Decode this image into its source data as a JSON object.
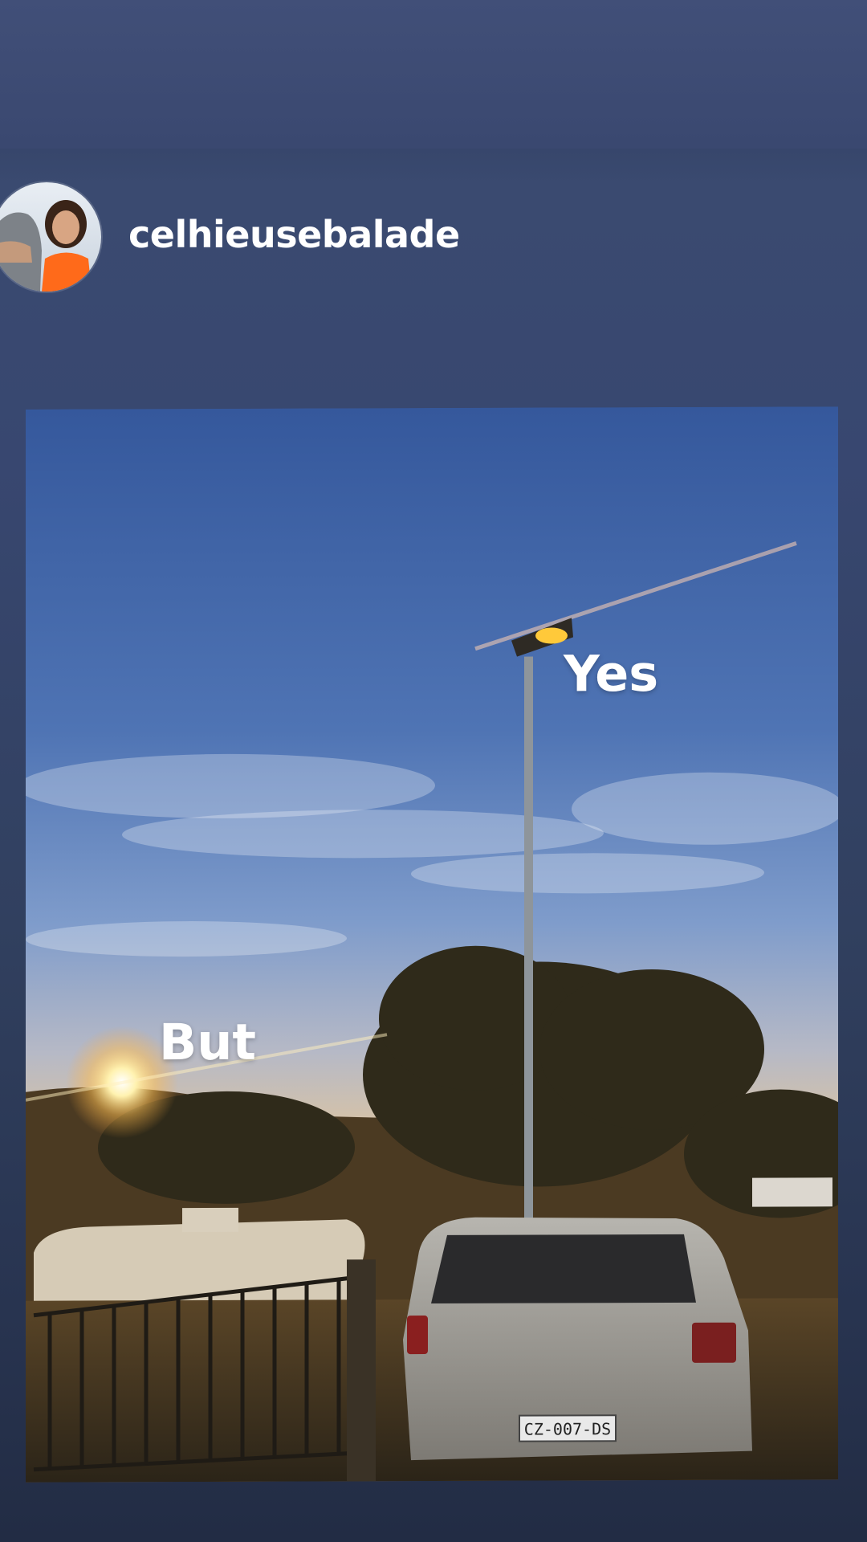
{
  "story": {
    "username": "celhieusebalade",
    "avatar_icon": "profile-avatar-icon",
    "stickers": {
      "yes": "Yes",
      "but": "But"
    },
    "photo": {
      "license_plate": "CZ-007-DS"
    }
  },
  "colors": {
    "background_top": "#414f78",
    "background_bottom": "#222c44",
    "text": "#ffffff"
  }
}
